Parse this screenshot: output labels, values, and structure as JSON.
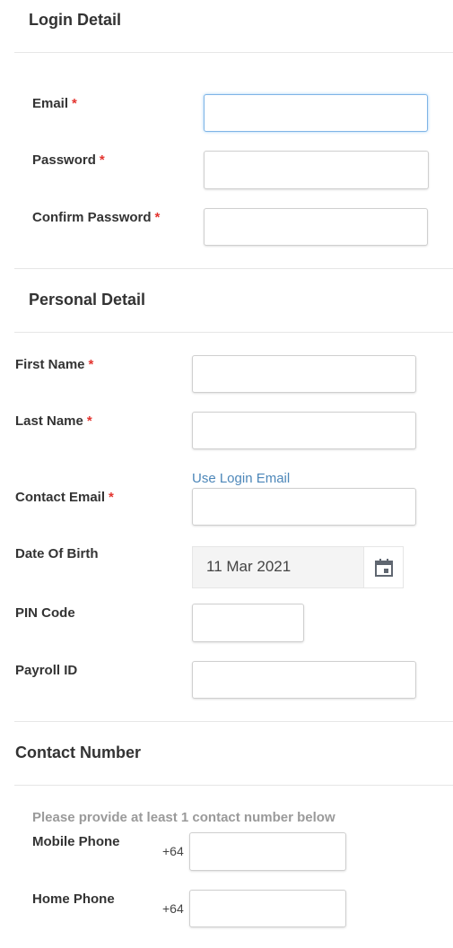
{
  "login_detail": {
    "title": "Login Detail",
    "email_label": "Email",
    "password_label": "Password",
    "confirm_password_label": "Confirm Password",
    "required_mark": "*"
  },
  "personal_detail": {
    "title": "Personal Detail",
    "first_name_label": "First Name",
    "last_name_label": "Last Name",
    "use_login_email_link": "Use Login Email",
    "contact_email_label": "Contact Email",
    "dob_label": "Date Of Birth",
    "dob_value": "11 Mar 2021",
    "pin_label": "PIN Code",
    "payroll_label": "Payroll ID",
    "required_mark": "*"
  },
  "contact_number": {
    "title": "Contact Number",
    "hint": "Please provide at least 1 contact number below",
    "mobile_label": "Mobile Phone",
    "home_label": "Home Phone",
    "country_prefix": "+64"
  },
  "icons": {
    "calendar": "calendar-icon"
  },
  "colors": {
    "required": "#e3342f",
    "link": "#4d87b9",
    "focus": "#7fb4e6"
  }
}
